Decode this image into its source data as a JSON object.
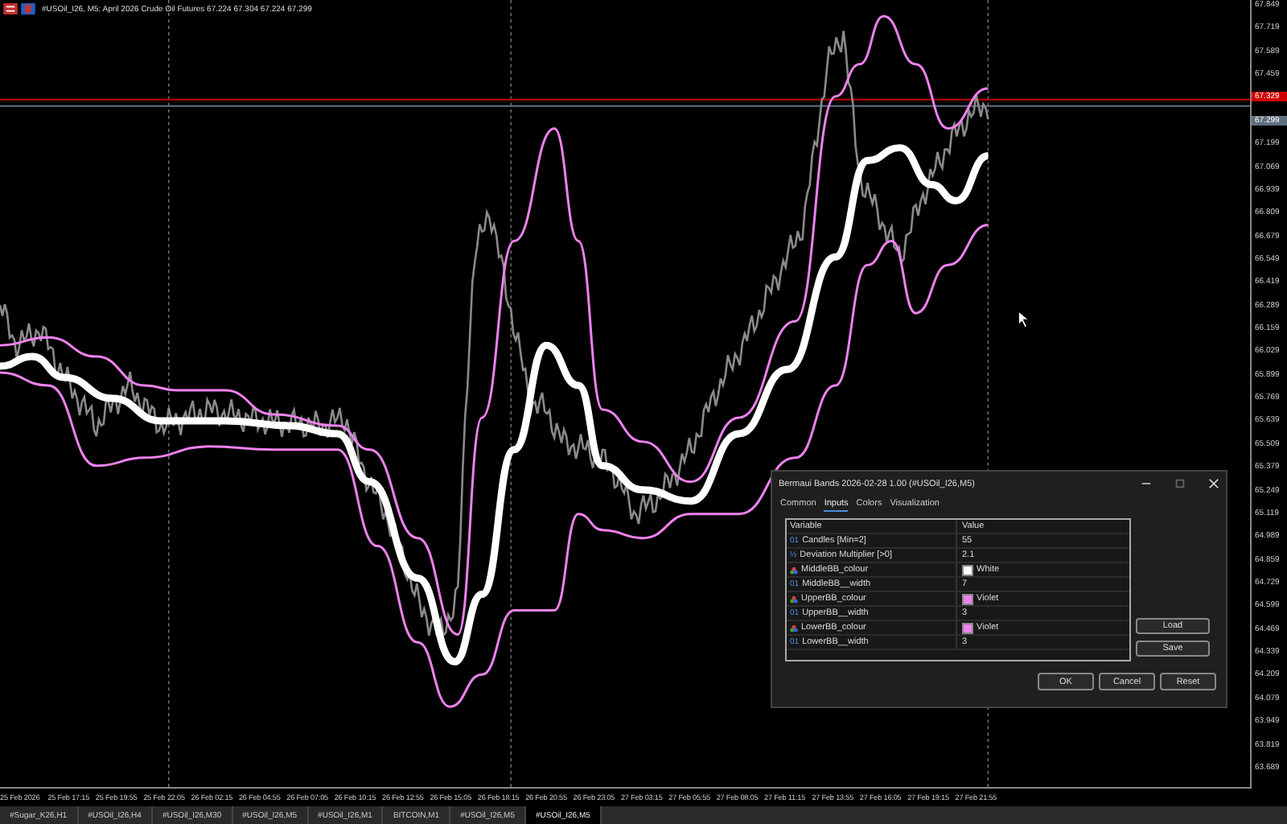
{
  "window": {
    "title": "#USOil_I26, M5: April 2026 Crude Oil Futures 67.224 67.304 67.224 67.299"
  },
  "price_axis": {
    "upper_labels": [
      "67.849",
      "67.719",
      "67.589",
      "67.459"
    ],
    "ask_price": "67.329",
    "bid_price": "67.299",
    "lower_labels": [
      "67.199",
      "67.069",
      "66.939",
      "66.809",
      "66.679",
      "66.549",
      "66.419",
      "66.289",
      "66.159",
      "66.029",
      "65.899",
      "65.769",
      "65.639",
      "65.509",
      "65.379",
      "65.249",
      "65.119",
      "64.989",
      "64.859",
      "64.729",
      "64.599",
      "64.469",
      "64.339",
      "64.209",
      "64.079",
      "63.949",
      "63.819",
      "63.689"
    ]
  },
  "time_axis": {
    "labels": [
      "25 Feb 2026",
      "25 Feb 17:15",
      "25 Feb 19:55",
      "25 Feb 22:05",
      "26 Feb 02:15",
      "26 Feb 04:55",
      "26 Feb 07:05",
      "26 Feb 10:15",
      "26 Feb 12:55",
      "26 Feb 15:05",
      "26 Feb 18:15",
      "26 Feb 20:55",
      "26 Feb 23:05",
      "27 Feb 03:15",
      "27 Feb 05:55",
      "27 Feb 08:05",
      "27 Feb 11:15",
      "27 Feb 13:55",
      "27 Feb 16:05",
      "27 Feb 19:15",
      "27 Feb 21:55"
    ]
  },
  "symbol_tabs": [
    {
      "label": "#Sugar_K26,H1",
      "selected": false
    },
    {
      "label": "#USOil_I26,H4",
      "selected": false
    },
    {
      "label": "#USOil_I26,M30",
      "selected": false
    },
    {
      "label": "#USOil_I26,M5",
      "selected": false
    },
    {
      "label": "#USOil_I26,M1",
      "selected": false
    },
    {
      "label": "BITCOIN,M1",
      "selected": false
    },
    {
      "label": "#USOil_I26,M5",
      "selected": false
    },
    {
      "label": "#USOil_I26,M5",
      "selected": true
    }
  ],
  "dialog": {
    "title": "Bermaui Bands 2026-02-28 1.00 (#USOil_I26,M5)",
    "tabs": [
      {
        "label": "Common",
        "selected": false
      },
      {
        "label": "Inputs",
        "selected": true
      },
      {
        "label": "Colors",
        "selected": false
      },
      {
        "label": "Visualization",
        "selected": false
      }
    ],
    "columns": [
      "Variable",
      "Value"
    ],
    "rows": [
      {
        "kind": "int",
        "type_label": "01",
        "name": "Candles [Min=2]",
        "value": "55"
      },
      {
        "kind": "double",
        "type_label": "½",
        "name": "Deviation Multiplier [>0]",
        "value": "2.1"
      },
      {
        "kind": "color",
        "name": "MiddleBB_colour",
        "value": "White",
        "color": "#ffffff"
      },
      {
        "kind": "int",
        "type_label": "01",
        "name": "MiddleBB__width",
        "value": "7"
      },
      {
        "kind": "color",
        "name": "UpperBB_colour",
        "value": "Violet",
        "color": "#ee82ee"
      },
      {
        "kind": "int",
        "type_label": "01",
        "name": "UpperBB__width",
        "value": "3"
      },
      {
        "kind": "color",
        "name": "LowerBB_colour",
        "value": "Violet",
        "color": "#ee82ee"
      },
      {
        "kind": "int",
        "type_label": "01",
        "name": "LowerBB__width",
        "value": "3"
      }
    ],
    "side_buttons": [
      "Load",
      "Save"
    ],
    "buttons": [
      "OK",
      "Cancel",
      "Reset"
    ]
  }
}
